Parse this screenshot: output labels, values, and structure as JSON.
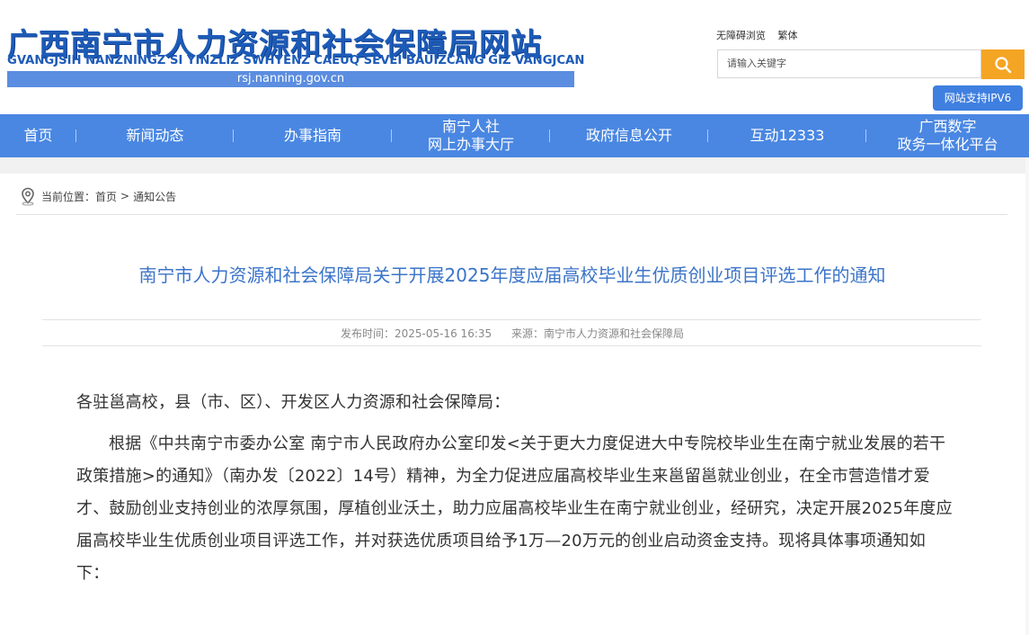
{
  "header": {
    "site_title": "广西南宁市人力资源和社会保障局网站",
    "site_title_roman": "GVANGJSIH NANZNINGZ SI YINZLIZ SWHYENZ CAEUQ SEVEI BAUIZCANG GIZ VANGJCAN",
    "domain": "rsj.nanning.gov.cn",
    "accessibility_link": "无障碍浏览",
    "traditional_link": "繁体",
    "search_placeholder": "请输入关键字",
    "search_icon": "search-icon",
    "ipv6_label": "网站支持IPV6"
  },
  "nav": {
    "items": [
      {
        "line1": "首页",
        "line2": ""
      },
      {
        "line1": "新闻动态",
        "line2": ""
      },
      {
        "line1": "办事指南",
        "line2": ""
      },
      {
        "line1": "南宁人社",
        "line2": "网上办事大厅"
      },
      {
        "line1": "政府信息公开",
        "line2": ""
      },
      {
        "line1": "互动12333",
        "line2": ""
      },
      {
        "line1": "广西数字",
        "line2": "政务一体化平台"
      }
    ]
  },
  "breadcrumb": {
    "prefix": "当前位置：",
    "home": "首页",
    "separator": ">",
    "current": "通知公告"
  },
  "article": {
    "title": "南宁市人力资源和社会保障局关于开展2025年度应届高校毕业生优质创业项目评选工作的通知",
    "publish_label": "发布时间：",
    "publish_time": "2025-05-16 16:35",
    "source_label": "来源：",
    "source": "南宁市人力资源和社会保障局",
    "salutation": "各驻邕高校，县（市、区）、开发区人力资源和社会保障局：",
    "paragraph1": "根据《中共南宁市委办公室 南宁市人民政府办公室印发<关于更大力度促进大中专院校毕业生在南宁就业发展的若干政策措施>的通知》（南办发〔2022〕14号）精神，为全力促进应届高校毕业生来邕留邕就业创业，在全市营造惜才爱才、鼓励创业支持创业的浓厚氛围，厚植创业沃土，助力应届高校毕业生在南宁就业创业，经研究，决定开展2025年度应届高校毕业生优质创业项目评选工作，并对获选优质项目给予1万—20万元的创业启动资金支持。现将具体事项通知如下："
  },
  "colors": {
    "brand_blue": "#4a87e2",
    "title_blue": "#3b74c9",
    "search_orange": "#f5a524"
  }
}
